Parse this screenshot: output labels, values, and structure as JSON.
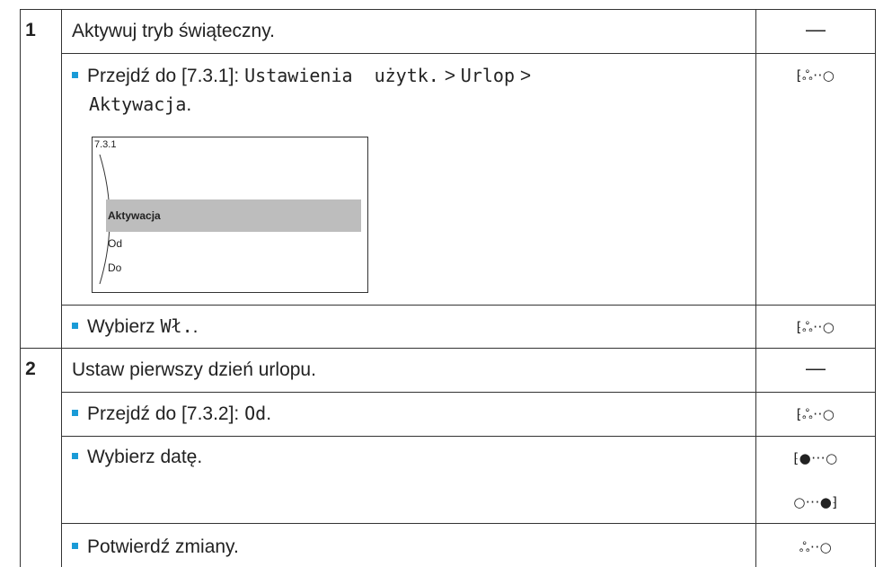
{
  "steps": [
    {
      "number": "1",
      "title": "Aktywuj tryb świąteczny.",
      "title_icon": "—",
      "substeps": [
        {
          "prefix": "Przejdź do [7.3.1]: ",
          "menu_path": "Ustawienia  użytk.",
          "sep1": " > ",
          "menu2": "Urlop",
          "sep2": " >",
          "menu3": "Aktywacja",
          "end": ".",
          "icon": "⁅ஃ··○"
        },
        {
          "prefix": "Wybierz ",
          "value": "Wł.",
          "end": ".",
          "icon": "⁅ஃ··○"
        }
      ],
      "screen": {
        "code": "7.3.1",
        "items": [
          "Aktywacja",
          "Od",
          "Do"
        ]
      }
    },
    {
      "number": "2",
      "title": "Ustaw pierwszy dzień urlopu.",
      "title_icon": "—",
      "substeps": [
        {
          "prefix": "Przejdź do [7.3.2]: ",
          "value": "Od",
          "end": ".",
          "icon": "⁅ஃ··○"
        },
        {
          "prefix": "Wybierz datę.",
          "icon": "⁅●···○",
          "icon2": "○···●⁆"
        },
        {
          "prefix": "Potwierdź zmiany.",
          "icon": "ஃ··○"
        }
      ]
    }
  ]
}
